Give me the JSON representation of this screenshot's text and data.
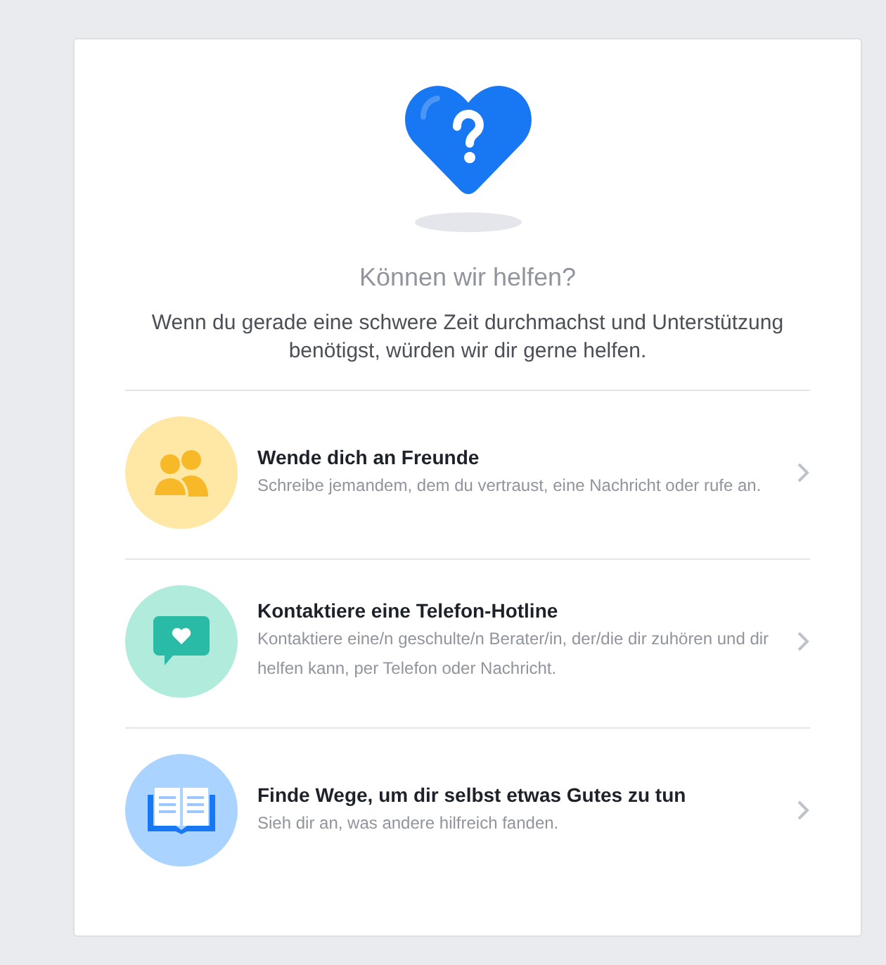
{
  "title": "Können wir helfen?",
  "intro": "Wenn du gerade eine schwere Zeit durchmachst und Unterstützung benötigst, würden wir dir gerne helfen.",
  "options": [
    {
      "kind": "friends",
      "color": "#ffe8a6",
      "title": "Wende dich an Freunde",
      "description": "Schreibe jemandem, dem du vertraust, eine Nachricht oder rufe an."
    },
    {
      "kind": "hotline",
      "color": "#b0ebdc",
      "title": "Kontaktiere eine Telefon-Hotline",
      "description": "Kontaktiere eine/n geschulte/n Berater/in, der/die dir zuhören und dir helfen kann, per Telefon oder Nachricht."
    },
    {
      "kind": "selfcare",
      "color": "#aad4ff",
      "title": "Finde Wege, um dir selbst etwas Gutes zu tun",
      "description": "Sieh dir an, was andere hilfreich fanden."
    }
  ]
}
